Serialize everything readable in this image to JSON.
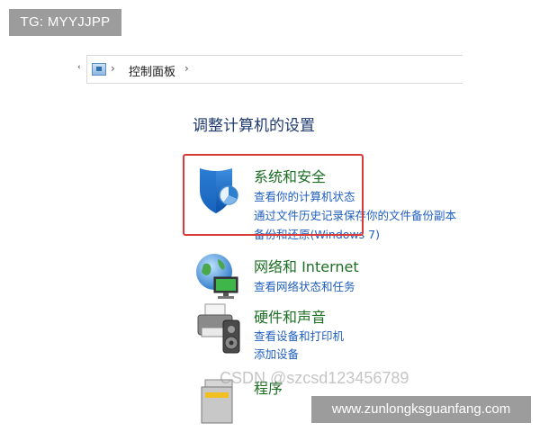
{
  "watermarks": {
    "tg": "TG: MYYJJPP",
    "csdn": "CSDN @szcsd123456789",
    "url": "www.zunlongksguanfang.com"
  },
  "address_bar": {
    "left_arrow": "‹",
    "sep1": "›",
    "path": "控制面板",
    "sep2": "›",
    "icon": "control-panel-icon"
  },
  "page_title": "调整计算机的设置",
  "categories": [
    {
      "heading": "系统和安全",
      "icon": "shield-icon",
      "links": [
        "查看你的计算机状态",
        "通过文件历史记录保存你的文件备份副本",
        "备份和还原(Windows 7)"
      ]
    },
    {
      "heading": "网络和 Internet",
      "icon": "network-globe-icon",
      "links": [
        "查看网络状态和任务"
      ]
    },
    {
      "heading": "硬件和声音",
      "icon": "printer-speaker-icon",
      "links": [
        "查看设备和打印机",
        "添加设备"
      ]
    },
    {
      "heading": "程序",
      "icon": "programs-icon",
      "links": []
    }
  ],
  "colors": {
    "highlight": "#d83a3a",
    "heading_green": "#1b6e23",
    "link_blue": "#1f5fbf",
    "title_blue": "#1e3a6e"
  }
}
